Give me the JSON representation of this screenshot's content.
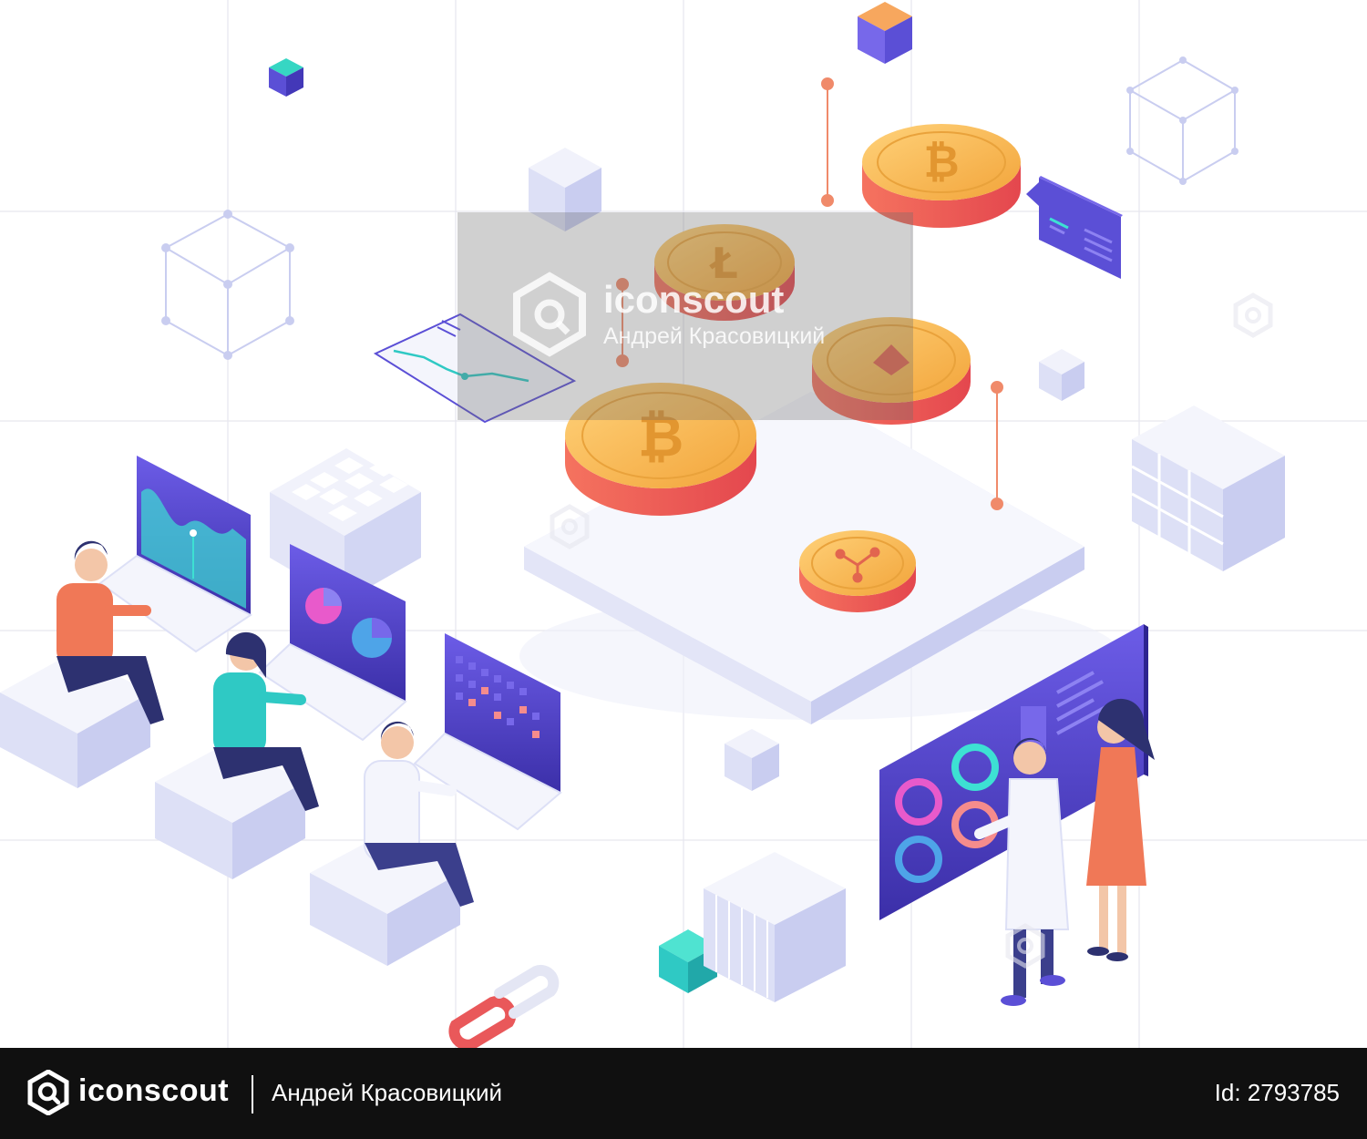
{
  "watermark": {
    "brand": "iconscout",
    "author": "Андрей Красовицкий"
  },
  "footer": {
    "brand": "iconscout",
    "author": "Андрей Красовицкий",
    "asset_id": "Id: 2793785"
  },
  "colors": {
    "accent_purple": "#5B4FD6",
    "coin_gold": "#F6B847",
    "coin_red": "#E9585A",
    "teal": "#2FC9C4",
    "footer_bg": "#101010"
  },
  "icons": [
    "bitcoin-coin-icon",
    "ethereum-coin-icon",
    "ripple-coin-icon",
    "litecoin-coin-icon",
    "chain-link-icon",
    "iconscout-logo-icon"
  ]
}
